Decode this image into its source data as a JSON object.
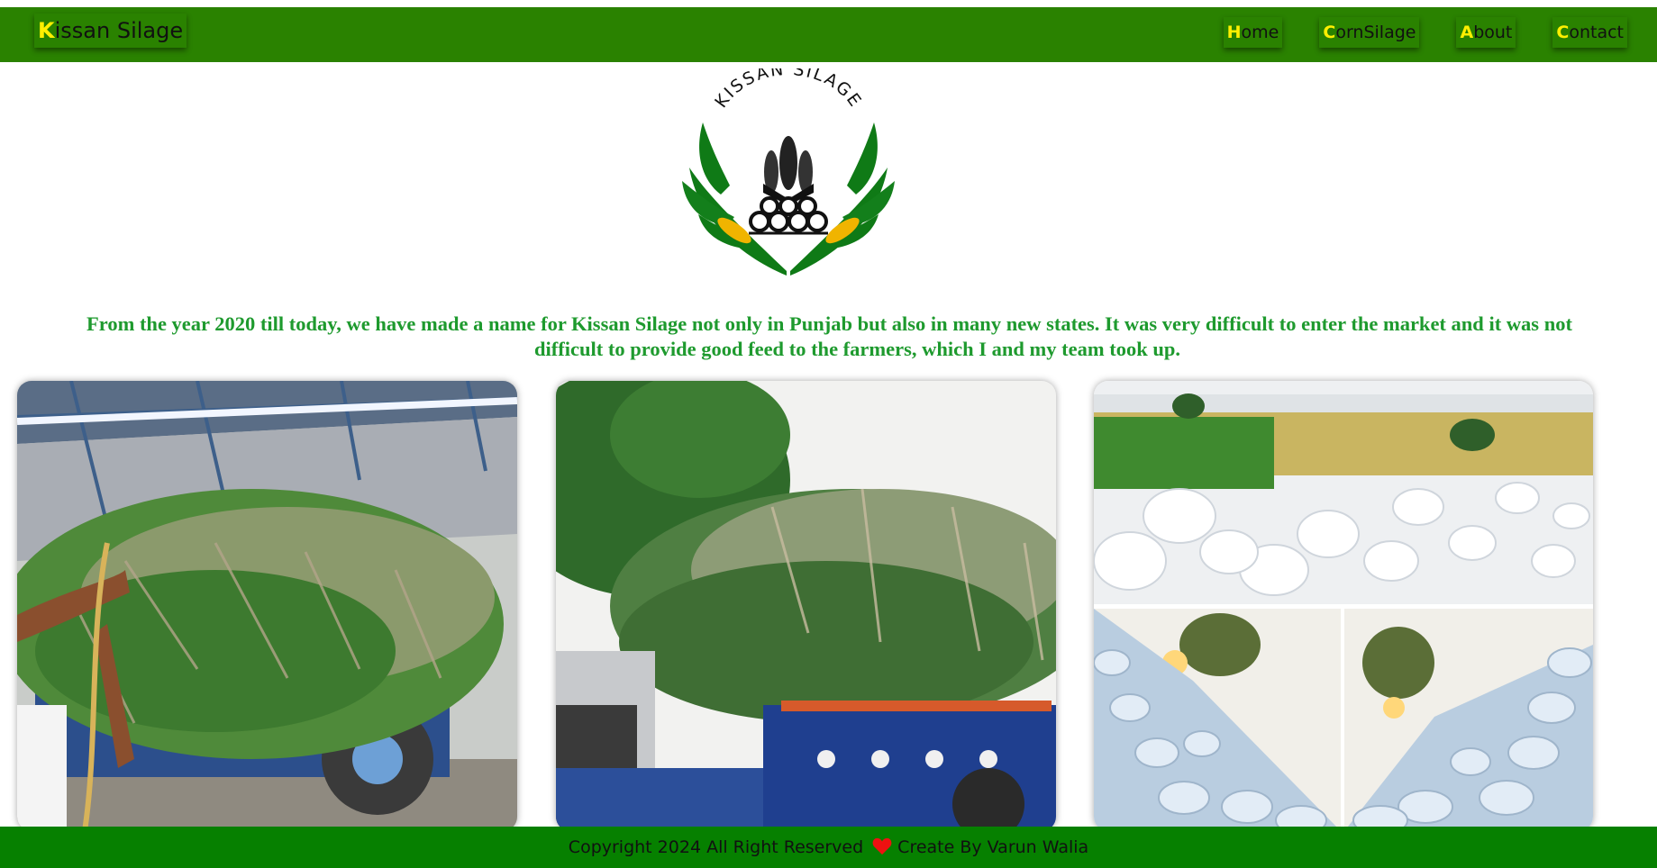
{
  "navbar": {
    "brand": {
      "first": "K",
      "rest": "issan Silage"
    },
    "links": [
      {
        "first": "H",
        "rest": "ome"
      },
      {
        "first": "C",
        "rest": "ornSilage"
      },
      {
        "first": "A",
        "rest": "bout"
      },
      {
        "first": "C",
        "rest": "ontact"
      }
    ],
    "colors": {
      "bar": "#2a8200",
      "first_letter": "#ffef00"
    }
  },
  "logo": {
    "text": "KISSAN SILAGE",
    "icon": "corn-wreath-logo"
  },
  "intro": {
    "line1": "From the year 2020 till today, we have made a name for Kissan Silage not only in Punjab but also in many new states. It was very difficult to enter the market and it was not",
    "line2": "difficult to provide good feed to the farmers, which I and my team took up.",
    "color": "#1e9a2e"
  },
  "gallery": [
    {
      "id": "photo-tractor-fodder",
      "subject": "green fodder loaded on tractor trolley under shed"
    },
    {
      "id": "photo-truck-fodder",
      "subject": "truck loaded with green maize fodder"
    },
    {
      "id": "photo-silage-bales",
      "subject": "white wrapped silage bales in field"
    }
  ],
  "footer": {
    "left": "Copyright 2024 All Right Reserved",
    "right": "Create By Varun Walia",
    "icon": "heart-icon",
    "color": "#068000"
  }
}
